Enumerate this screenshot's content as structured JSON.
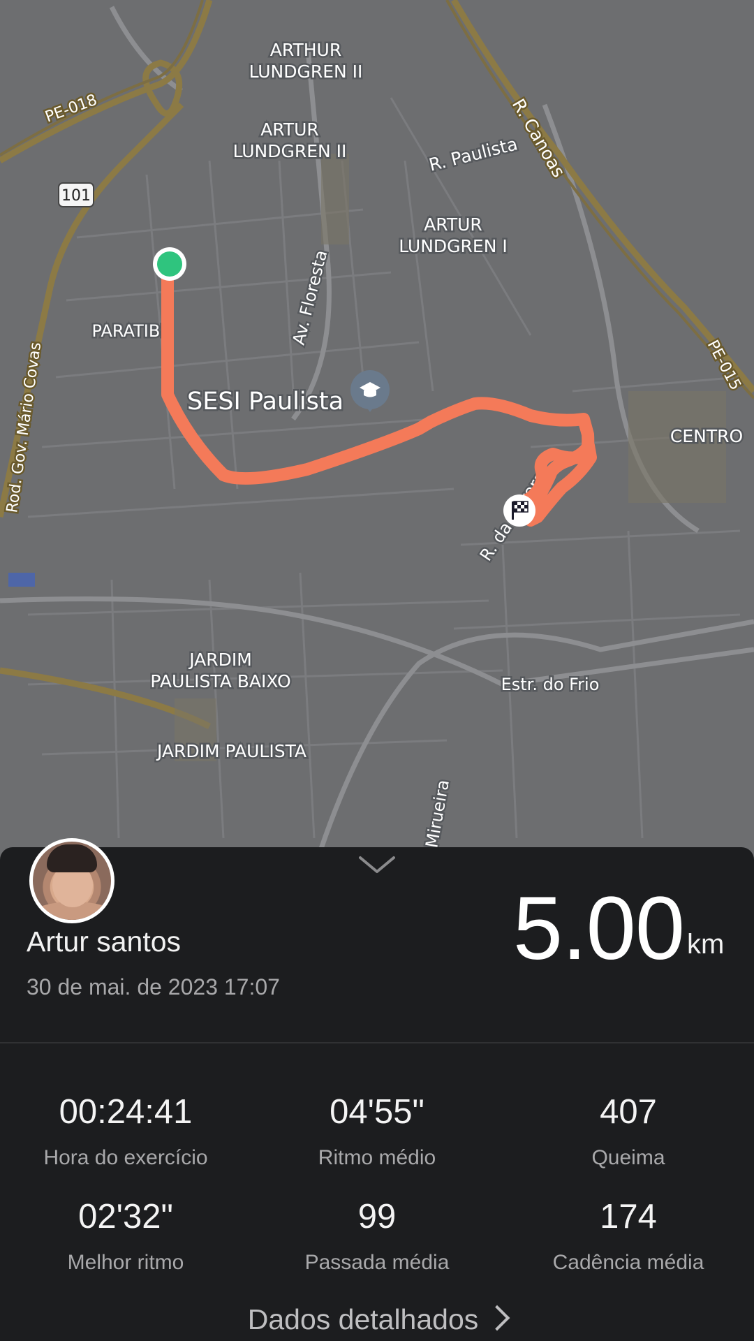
{
  "map": {
    "labels": {
      "arthur_lundgren_ii": [
        "ARTHUR",
        "LUNDGREN II"
      ],
      "artur_lundgren_ii": [
        "ARTUR",
        "LUNDGREN II"
      ],
      "artur_lundgren_i": [
        "ARTUR",
        "LUNDGREN I"
      ],
      "r_paulista": "R. Paulista",
      "r_canoas": "R. Canoas",
      "pe018": "PE-018",
      "pe015": "PE-015",
      "road101": "101",
      "rod_gov": "Rod. Gov. Mário Covas",
      "paratibe": "PARATIBE",
      "av_floresta": "Av. Floresta",
      "sesi": "SESI Paulista",
      "centro": "CENTRO",
      "r_aurora": "R. da Aurora",
      "jardim_baixo": [
        "JARDIM",
        "PAULISTA BAIXO"
      ],
      "jardim_paulista": "JARDIM PAULISTA",
      "estr_frio": "Estr. do Frio",
      "mirueira": "Mirueira"
    },
    "route_color": "#f47a59",
    "start_color": "#2fc47e"
  },
  "summary": {
    "user_name": "Artur santos",
    "date": "30 de mai. de 2023 17:07",
    "distance": "5.00",
    "unit": "km"
  },
  "stats": [
    {
      "value": "00:24:41",
      "label": "Hora do exercício"
    },
    {
      "value": "04'55\"",
      "label": "Ritmo médio"
    },
    {
      "value": "407",
      "label": "Queima"
    },
    {
      "value": "02'32\"",
      "label": "Melhor ritmo"
    },
    {
      "value": "99",
      "label": "Passada média"
    },
    {
      "value": "174",
      "label": "Cadência média"
    }
  ],
  "detail_link": "Dados detalhados"
}
